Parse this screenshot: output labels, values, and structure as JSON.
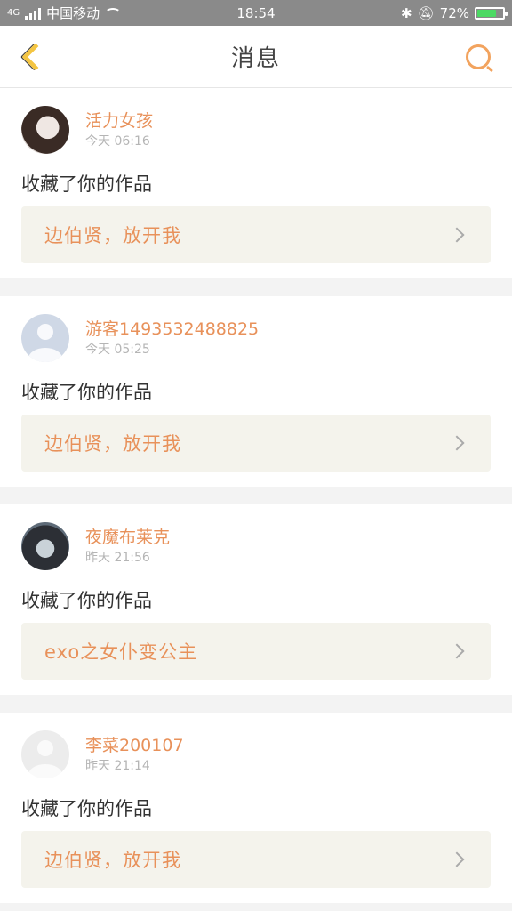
{
  "status_bar": {
    "network": "4G",
    "carrier": "中国移动",
    "time": "18:54",
    "battery": "72%",
    "bluetooth_icon": "bluetooth-icon",
    "silent_icon": "bell-off-icon"
  },
  "header": {
    "title": "消息",
    "back_icon": "chevron-left-icon",
    "search_icon": "search-icon",
    "accent_color": "#f4c542",
    "search_color": "#f2a35e"
  },
  "notifications": [
    {
      "username": "活力女孩",
      "time": "今天 06:16",
      "action": "收藏了你的作品",
      "work_title": "边伯贤，放开我"
    },
    {
      "username": "游客1493532488825",
      "time": "今天 05:25",
      "action": "收藏了你的作品",
      "work_title": "边伯贤，放开我"
    },
    {
      "username": "夜魔布莱克",
      "time": "昨天 21:56",
      "action": "收藏了你的作品",
      "work_title": "exo之女仆变公主"
    },
    {
      "username": "李菜200107",
      "time": "昨天 21:14",
      "action": "收藏了你的作品",
      "work_title": "边伯贤，放开我"
    }
  ],
  "colors": {
    "name": "#e8915a",
    "link_background": "#f4f3ec"
  }
}
